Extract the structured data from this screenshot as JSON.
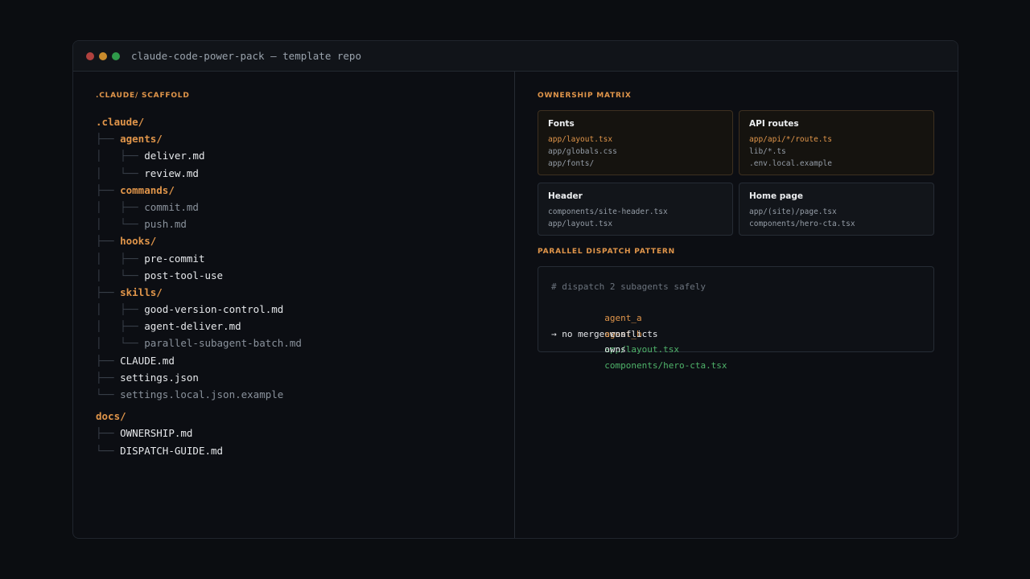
{
  "window": {
    "title": "claude-code-power-pack — template repo",
    "controls": [
      {
        "name": "close",
        "color": "#b0413e"
      },
      {
        "name": "minimize",
        "color": "#c98b2c"
      },
      {
        "name": "maximize",
        "color": "#2f9a4a"
      }
    ]
  },
  "left": {
    "section_label": ".CLAUDE/ SCAFFOLD",
    "tree": [
      {
        "prefix": "",
        "name": ".claude/",
        "kind": "root"
      },
      {
        "prefix": "├── ",
        "name": "agents/",
        "kind": "dir"
      },
      {
        "prefix": "│   ├── ",
        "name": "deliver.md",
        "kind": "file"
      },
      {
        "prefix": "│   └── ",
        "name": "review.md",
        "kind": "file"
      },
      {
        "prefix": "├── ",
        "name": "commands/",
        "kind": "dir"
      },
      {
        "prefix": "│   ├── ",
        "name": "commit.md",
        "kind": "muted"
      },
      {
        "prefix": "│   └── ",
        "name": "push.md",
        "kind": "muted"
      },
      {
        "prefix": "├── ",
        "name": "hooks/",
        "kind": "dir"
      },
      {
        "prefix": "│   ├── ",
        "name": "pre-commit",
        "kind": "file"
      },
      {
        "prefix": "│   └── ",
        "name": "post-tool-use",
        "kind": "file"
      },
      {
        "prefix": "├── ",
        "name": "skills/",
        "kind": "dir"
      },
      {
        "prefix": "│   ├── ",
        "name": "good-version-control.md",
        "kind": "file"
      },
      {
        "prefix": "│   ├── ",
        "name": "agent-deliver.md",
        "kind": "file"
      },
      {
        "prefix": "│   └── ",
        "name": "parallel-subagent-batch.md",
        "kind": "muted"
      },
      {
        "prefix": "├── ",
        "name": "CLAUDE.md",
        "kind": "file"
      },
      {
        "prefix": "├── ",
        "name": "settings.json",
        "kind": "file"
      },
      {
        "prefix": "└── ",
        "name": "settings.local.json.example",
        "kind": "muted"
      },
      {
        "prefix": "",
        "name": "docs/",
        "kind": "root",
        "gap": true
      },
      {
        "prefix": "├── ",
        "name": "OWNERSHIP.md",
        "kind": "file"
      },
      {
        "prefix": "└── ",
        "name": "DISPATCH-GUIDE.md",
        "kind": "file"
      }
    ]
  },
  "right": {
    "ownership_label": "OWNERSHIP MATRIX",
    "cards": [
      {
        "title": "Fonts",
        "tone": "warm",
        "lines": [
          "app/layout.tsx",
          "app/globals.css",
          "app/fonts/"
        ],
        "highlight_first": true
      },
      {
        "title": "API routes",
        "tone": "warm",
        "lines": [
          "app/api/*/route.ts",
          "lib/*.ts",
          ".env.local.example"
        ],
        "highlight_first": true
      },
      {
        "title": "Header",
        "tone": "cool",
        "lines": [
          "components/site-header.tsx",
          "app/layout.tsx"
        ],
        "highlight_first": false
      },
      {
        "title": "Home page",
        "tone": "cool",
        "lines": [
          "app/(site)/page.tsx",
          "components/hero-cta.tsx"
        ],
        "highlight_first": false
      }
    ],
    "dispatch_label": "PARALLEL DISPATCH PATTERN",
    "code": {
      "comment": "# dispatch 2 subagents safely",
      "lines": [
        {
          "agent": "agent_a",
          "verb": "owns",
          "path": "app/layout.tsx"
        },
        {
          "agent": "agent_b",
          "verb": "owns",
          "path": "components/hero-cta.tsx"
        }
      ],
      "result": "→ no merge conflicts"
    }
  },
  "colors": {
    "accent": "#e0954a",
    "path_green": "#4fb36a",
    "background": "#0b0d11"
  }
}
